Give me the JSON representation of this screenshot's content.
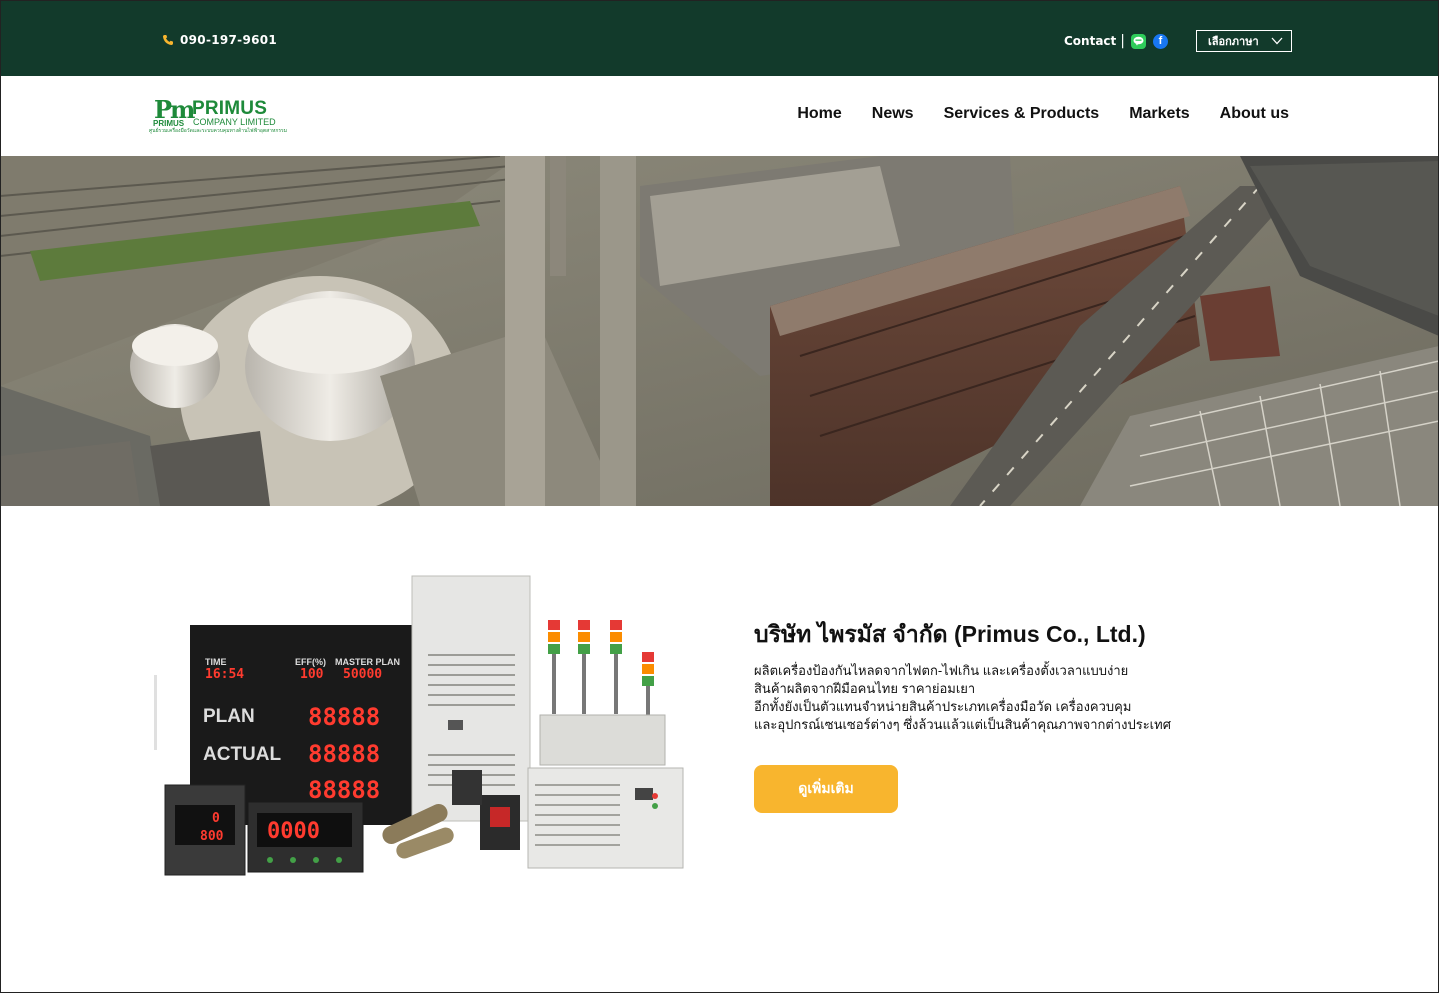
{
  "topbar": {
    "phone": "090-197-9601",
    "contact_label": "Contact",
    "contact_separator": "|",
    "language_label": "เลือกภาษา",
    "colors": {
      "background": "#123a2b",
      "line": "#2ecc5a",
      "facebook": "#1877f2",
      "phone_icon": "#f8b52e"
    }
  },
  "header": {
    "logo": {
      "mark": "Pm",
      "mark_small": "PRIMUS",
      "name": "PRIMUS",
      "company": "COMPANY LIMITED",
      "tagline": "ศูนย์รวมเครื่องมือวัดและระบบควบคุมทางด้านไฟฟ้าอุตสาหกรรม"
    },
    "nav": [
      {
        "label": "Home"
      },
      {
        "label": "News"
      },
      {
        "label": "Services & Products"
      },
      {
        "label": "Markets"
      },
      {
        "label": "About us"
      }
    ]
  },
  "hero": {
    "alt": "Aerial view of an industrial power plant"
  },
  "intro": {
    "title": "บริษัท ไพรมัส จำกัด (Primus Co., Ltd.)",
    "lines": [
      "ผลิตเครื่องป้องกันไหลดจากไฟตก-ไฟเกิน และเครื่องตั้งเวลาแบบง่าย",
      "สินค้าผลิตจากฝีมือคนไทย ราคาย่อมเยา",
      "อีกทั้งยังเป็นตัวแทนจำหน่ายสินค้าประเภทเครื่องมือวัด เครื่องควบคุม",
      "และอุปกรณ์เซนเซอร์ต่างๆ ซึ่งล้วนแล้วแต่เป็นสินค้าคุณภาพจากต่างประเทศ"
    ],
    "cta_label": "ดูเพิ่มเติม",
    "cta_color": "#f8b52e"
  },
  "products_display": {
    "time_label": "TIME",
    "time_value": "16:54",
    "eff_label": "EFF(%)",
    "eff_value": "100",
    "master_label": "MASTER PLAN",
    "master_value": "50000",
    "plan_label": "PLAN",
    "plan_value": "88888",
    "actual_label": "ACTUAL",
    "actual_value": "88888",
    "third_value": "88888",
    "meter1_top": "0",
    "meter1_bottom": "800",
    "meter2_value": "0000"
  }
}
